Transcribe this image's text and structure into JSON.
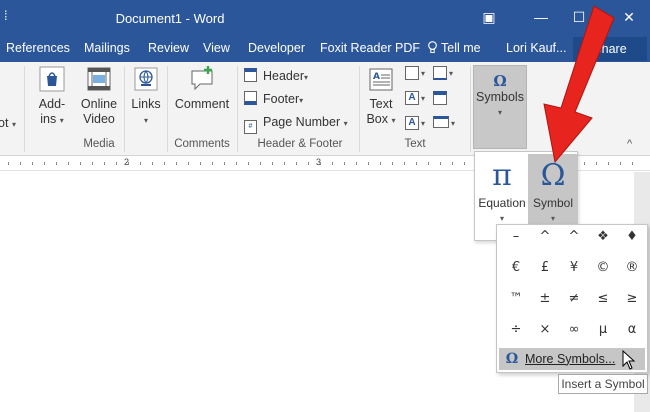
{
  "window": {
    "title": "Document1 - Word",
    "restore_glyph": "▣",
    "minimize_glyph": "—",
    "maximize_glyph": "☐",
    "close_glyph": "✕"
  },
  "tabs": {
    "items": [
      "References",
      "Mailings",
      "Review",
      "View",
      "Developer",
      "Foxit Reader PDF"
    ],
    "tell_me": "Tell me",
    "user": "Lori Kauf...",
    "share": "Share"
  },
  "ribbon": {
    "addins": {
      "label_line1": "Add-",
      "label_line2": "ins",
      "truncated_left": "ot"
    },
    "online_video": {
      "label_line1": "Online",
      "label_line2": "Video"
    },
    "links": {
      "label": "Links"
    },
    "comment": {
      "label": "Comment"
    },
    "header": {
      "label": "Header"
    },
    "footer": {
      "label": "Footer"
    },
    "page_number": {
      "label": "Page Number"
    },
    "text_box": {
      "label_line1": "Text",
      "label_line2": "Box"
    },
    "symbols": {
      "label": "Symbols",
      "glyph": "Ω"
    },
    "groups": {
      "media": "Media",
      "comments": "Comments",
      "header_footer": "Header & Footer",
      "text": "Text"
    },
    "collapse_glyph": "^"
  },
  "ruler": {
    "numbers": [
      "2",
      "3"
    ]
  },
  "symbols_dropdown": {
    "equation": {
      "glyph": "π",
      "label": "Equation"
    },
    "symbol": {
      "glyph": "Ω",
      "label": "Symbol"
    }
  },
  "gallery": {
    "symbols": [
      "–",
      "^",
      "^",
      "❖",
      "♦",
      "€",
      "£",
      "¥",
      "©",
      "®",
      "™",
      "±",
      "≠",
      "≤",
      "≥",
      "÷",
      "×",
      "∞",
      "µ",
      "α"
    ],
    "more_glyph": "Ω",
    "more_label": "More Symbols..."
  },
  "tooltip": "Insert a Symbol",
  "colors": {
    "accent": "#2b579a",
    "annotation_arrow": "#e8241f"
  }
}
